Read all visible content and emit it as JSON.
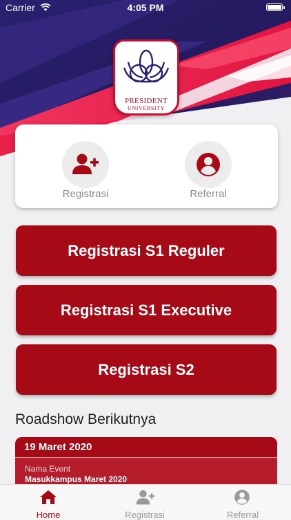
{
  "status_bar": {
    "carrier": "Carrier",
    "time": "4:05 PM"
  },
  "logo": {
    "line1": "PRESIDENT",
    "line2": "UNIVERSITY"
  },
  "quick_actions": [
    {
      "label": "Registrasi",
      "icon": "add-user-icon"
    },
    {
      "label": "Referral",
      "icon": "user-circle-icon"
    }
  ],
  "buttons": [
    {
      "label": "Registrasi S1 Reguler"
    },
    {
      "label": "Registrasi S1 Executive"
    },
    {
      "label": "Registrasi S2"
    }
  ],
  "roadshow": {
    "title": "Roadshow Berikutnya",
    "event": {
      "date": "19 Maret 2020",
      "name_label": "Nama Event",
      "name_value": "Masukkampus Maret 2020"
    }
  },
  "tabbar": [
    {
      "label": "Home",
      "icon": "home-icon",
      "active": true
    },
    {
      "label": "Registrasi",
      "icon": "add-user-icon",
      "active": false
    },
    {
      "label": "Referral",
      "icon": "user-circle-icon",
      "active": false
    }
  ],
  "colors": {
    "primary": "#a60a16",
    "hero_navy": "#261a66",
    "hero_red": "#e8204a",
    "inactive": "#9a9a9a"
  }
}
